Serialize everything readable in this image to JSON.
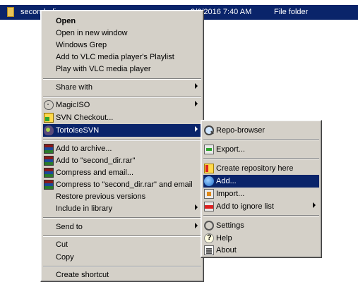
{
  "file_row": {
    "name": "second_dir",
    "date": "3/6/2016 7:40 AM",
    "type": "File folder"
  },
  "context_menu": {
    "open": "Open",
    "open_new_window": "Open in new window",
    "windows_grep": "Windows Grep",
    "add_vlc_playlist": "Add to VLC media player's Playlist",
    "play_vlc": "Play with VLC media player",
    "share_with": "Share with",
    "magiciso": "MagicISO",
    "svn_checkout": "SVN Checkout...",
    "tortoisesvn": "TortoiseSVN",
    "add_to_archive": "Add to archive...",
    "add_to_rar": "Add to \"second_dir.rar\"",
    "compress_email": "Compress and email...",
    "compress_rar_email": "Compress to \"second_dir.rar\" and email",
    "restore_previous": "Restore previous versions",
    "include_library": "Include in library",
    "send_to": "Send to",
    "cut": "Cut",
    "copy": "Copy",
    "create_shortcut": "Create shortcut"
  },
  "tortoise_submenu": {
    "repo_browser": "Repo-browser",
    "export": "Export...",
    "create_repo": "Create repository here",
    "add": "Add...",
    "import": "Import...",
    "add_ignore": "Add to ignore list",
    "settings": "Settings",
    "help": "Help",
    "about": "About"
  },
  "colors": {
    "selection": "#0a246a",
    "menu_bg": "#d4d0c8"
  }
}
